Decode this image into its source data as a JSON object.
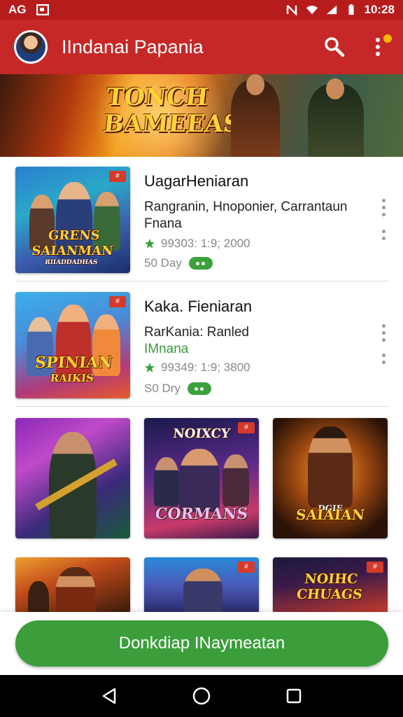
{
  "status_bar": {
    "left_text": "AG",
    "time": "10:28"
  },
  "app_bar": {
    "title": "IIndanai Papania"
  },
  "banner": {
    "title_line1": "TONCH",
    "title_line2": "BAMEEAS"
  },
  "list": [
    {
      "title": "UagarHeniaran",
      "subtitle": "Rangranin, Hnoponier, Carrantaun",
      "subtitle2": "Fnana",
      "subtitle2_color": "#222222",
      "meta": "99303: 1:9; 2000",
      "price": "50 Day",
      "caption_line1": "GRENS",
      "caption_line2": "SAIANMAN",
      "caption_line3": "RIIADDADHAS"
    },
    {
      "title": "Kaka. Fieniaran",
      "subtitle": "RarKania: Ranled",
      "subtitle2": "IMnana",
      "subtitle2_color": "#3a9a3a",
      "meta": "99349: 1:9; 3800",
      "price": "S0 Dry",
      "caption_line1": "SPINIAN",
      "caption_line2": "RAIKIS",
      "caption_line3": ""
    }
  ],
  "grid": [
    {
      "caption": ""
    },
    {
      "caption_top": "NOIXCY",
      "caption": "CORMANS"
    },
    {
      "caption": "SAIAIAN",
      "caption_top": "DGIE"
    },
    {
      "caption": ""
    },
    {
      "caption": ""
    },
    {
      "caption": "NOIHC CHUAGS"
    }
  ],
  "cta": {
    "label": "Donkdiap INaymeatan"
  },
  "colors": {
    "primary": "#c62828",
    "status_bar": "#b71c1c",
    "accent_green": "#3b9e3b"
  },
  "icons": {
    "search": "search-icon",
    "more": "more-vert-icon",
    "back": "back-icon",
    "home": "home-icon",
    "recents": "recents-icon"
  }
}
